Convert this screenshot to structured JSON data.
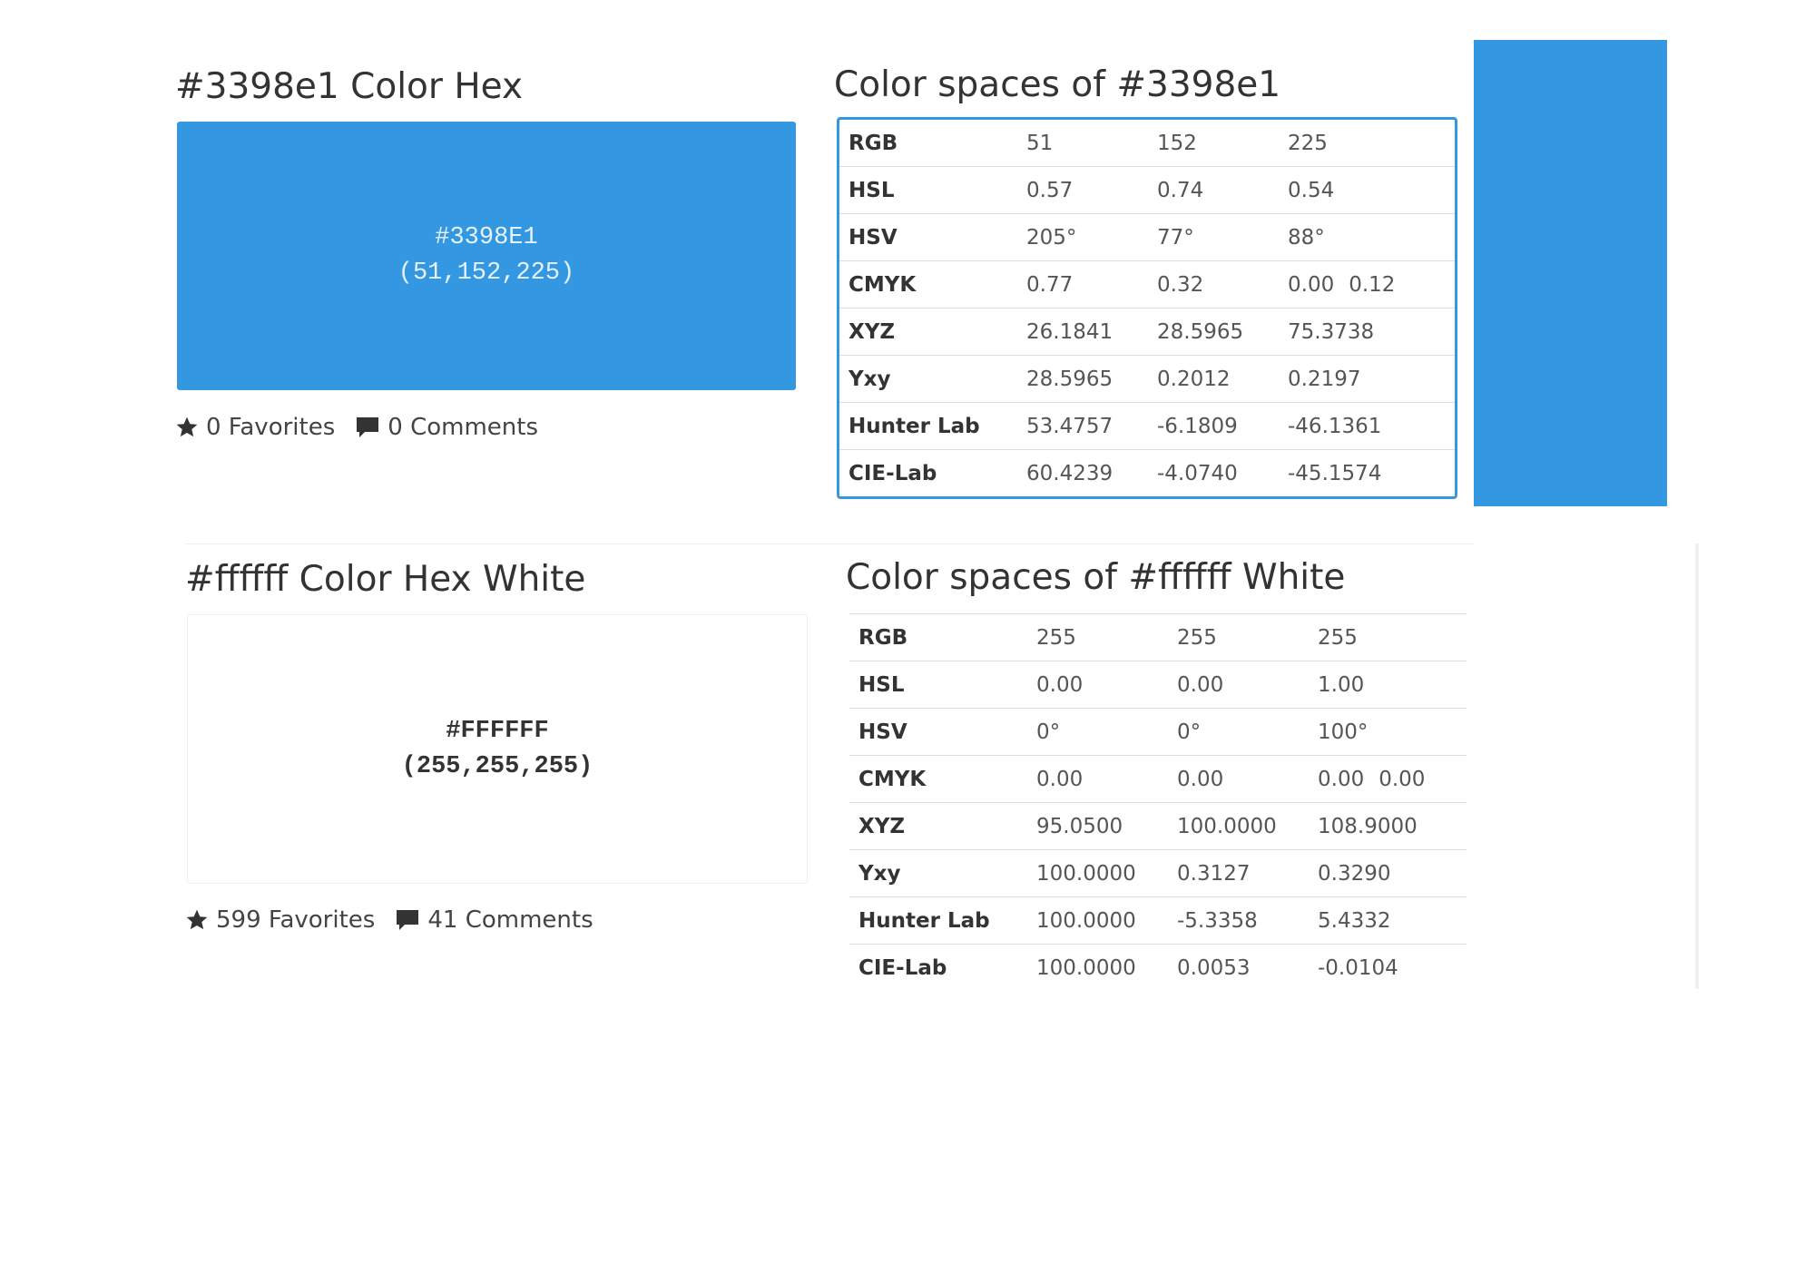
{
  "colors": {
    "accent": "#3398e1",
    "white": "#ffffff"
  },
  "section_blue": {
    "heading": "#3398e1 Color Hex",
    "swatch_hex": "#3398E1",
    "swatch_rgb": "(51,152,225)",
    "favorites_icon": "star-icon",
    "favorites": "0 Favorites",
    "comments_icon": "comment-icon",
    "comments": "0 Comments",
    "table_title": "Color spaces of #3398e1",
    "rows": [
      {
        "label": "RGB",
        "v1": "51",
        "v2": "152",
        "v3": "225",
        "v4": ""
      },
      {
        "label": "HSL",
        "v1": "0.57",
        "v2": "0.74",
        "v3": "0.54",
        "v4": ""
      },
      {
        "label": "HSV",
        "v1": "205°",
        "v2": "77°",
        "v3": "88°",
        "v4": ""
      },
      {
        "label": "CMYK",
        "v1": "0.77",
        "v2": "0.32",
        "v3": "0.00",
        "v4": "0.12"
      },
      {
        "label": "XYZ",
        "v1": "26.1841",
        "v2": "28.5965",
        "v3": "75.3738",
        "v4": ""
      },
      {
        "label": "Yxy",
        "v1": "28.5965",
        "v2": "0.2012",
        "v3": "0.2197",
        "v4": ""
      },
      {
        "label": "Hunter Lab",
        "v1": "53.4757",
        "v2": "-6.1809",
        "v3": "-46.1361",
        "v4": ""
      },
      {
        "label": "CIE-Lab",
        "v1": "60.4239",
        "v2": "-4.0740",
        "v3": "-45.1574",
        "v4": ""
      }
    ]
  },
  "section_white": {
    "heading": "#ffffff Color Hex White",
    "swatch_hex": "#FFFFFF",
    "swatch_rgb": "(255,255,255)",
    "favorites_icon": "star-icon",
    "favorites": "599 Favorites",
    "comments_icon": "comment-icon",
    "comments": "41 Comments",
    "table_title": "Color spaces of #ffffff White",
    "rows": [
      {
        "label": "RGB",
        "v1": "255",
        "v2": "255",
        "v3": "255",
        "v4": ""
      },
      {
        "label": "HSL",
        "v1": "0.00",
        "v2": "0.00",
        "v3": "1.00",
        "v4": ""
      },
      {
        "label": "HSV",
        "v1": "0°",
        "v2": "0°",
        "v3": "100°",
        "v4": ""
      },
      {
        "label": "CMYK",
        "v1": "0.00",
        "v2": "0.00",
        "v3": "0.00",
        "v4": "0.00"
      },
      {
        "label": "XYZ",
        "v1": "95.0500",
        "v2": "100.0000",
        "v3": "108.9000",
        "v4": ""
      },
      {
        "label": "Yxy",
        "v1": "100.0000",
        "v2": "0.3127",
        "v3": "0.3290",
        "v4": ""
      },
      {
        "label": "Hunter Lab",
        "v1": "100.0000",
        "v2": "-5.3358",
        "v3": "5.4332",
        "v4": ""
      },
      {
        "label": "CIE-Lab",
        "v1": "100.0000",
        "v2": "0.0053",
        "v3": "-0.0104",
        "v4": ""
      }
    ]
  }
}
